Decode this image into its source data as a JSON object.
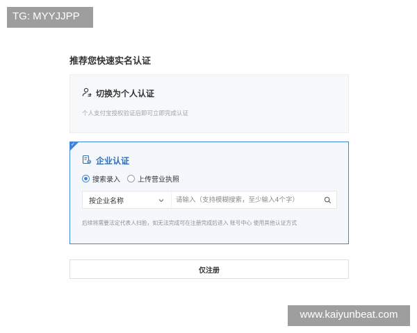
{
  "watermarks": {
    "top_left": "TG: MYYJJPP",
    "bottom_right": "www.kaiyunbeat.com"
  },
  "page_title": "推荐您快速实名认证",
  "personal_card": {
    "icon": "user-switch-icon",
    "title": "切换为个人认证",
    "description": "个人支付宝授权验证后即可立即完成认证"
  },
  "enterprise_card": {
    "icon": "enterprise-doc-icon",
    "title": "企业认证",
    "selected": true,
    "radio_options": [
      {
        "label": "搜索录入",
        "checked": true
      },
      {
        "label": "上传营业执照",
        "checked": false
      }
    ],
    "search": {
      "select_label": "按企业名称",
      "placeholder": "请输入（支持模糊搜索，至少输入4个字）"
    },
    "hint": "后续将需要法定代表人扫脸，如无法完成可在注册完成后进入 账号中心 使用其他认证方式"
  },
  "register_button": "仅注册",
  "colors": {
    "accent": "#3f86d9",
    "accent_text": "#2f6fb8",
    "card_bg": "#f7f8fa",
    "selected_bg": "#f4f8fc"
  }
}
